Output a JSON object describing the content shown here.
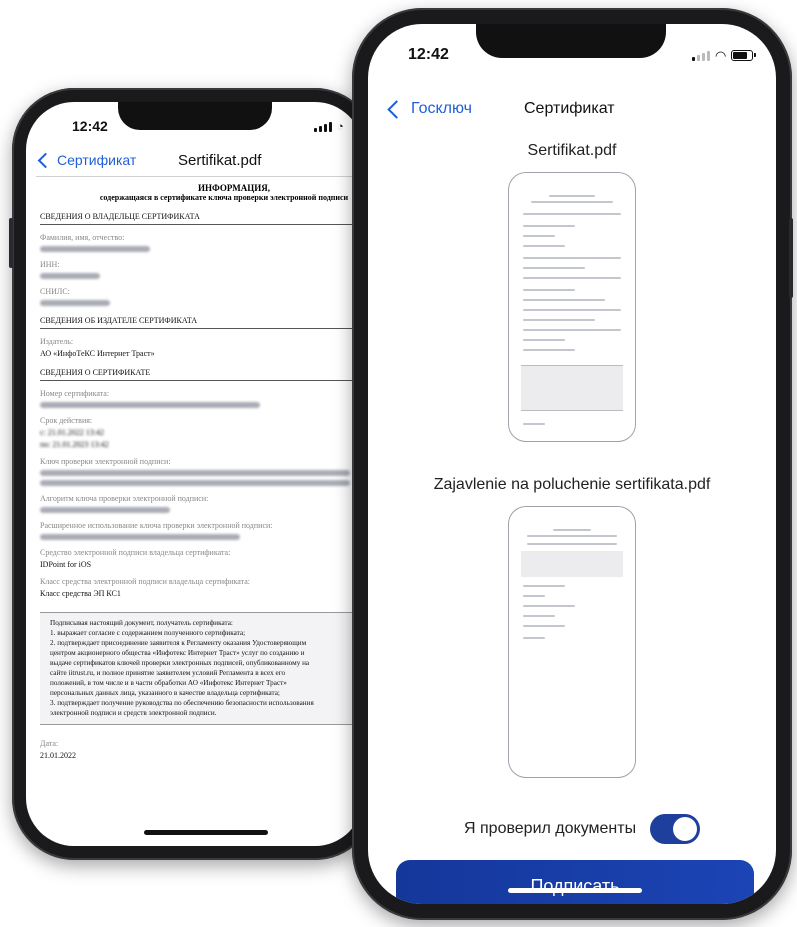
{
  "back_phone": {
    "status_time": "12:42",
    "nav": {
      "back_label": "Сертификат",
      "title": "Sertifikat.pdf"
    },
    "document": {
      "heading_line1": "ИНФОРМАЦИЯ,",
      "heading_line2": "содержащаяся в сертификате ключа проверки электронной подписи",
      "section_owner": "СВЕДЕНИЯ О ВЛАДЕЛЬЦЕ СЕРТИФИКАТА",
      "label_fio": "Фамилия, имя, отчество:",
      "label_inn": "ИНН:",
      "label_snils": "СНИЛС:",
      "section_issuer": "СВЕДЕНИЯ ОБ ИЗДАТЕЛЕ СЕРТИФИКАТА",
      "label_issuer": "Издатель:",
      "issuer_value": "АО «ИнфоТеКС Интернет Траст»",
      "section_cert": "СВЕДЕНИЯ О СЕРТИФИКАТЕ",
      "label_number": "Номер сертификата:",
      "label_validity": "Срок действия:",
      "validity_from": "с: 21.01.2022 13:42",
      "validity_to": "по: 21.01.2023 13:42",
      "label_key": "Ключ проверки электронной подписи:",
      "label_algorithm": "Алгоритм ключа проверки электронной подписи:",
      "label_usage": "Расширенное использование ключа проверки электронной подписи:",
      "label_tool": "Средство электронной подписи владельца сертификата:",
      "tool_value": "IDPoint for iOS",
      "label_class": "Класс средства электронной подписи владельца сертификата:",
      "class_value": "Класс средства ЭП КС1",
      "notice": [
        "Подписывая настоящий документ, получатель сертификата:",
        "1. выражает согласие с содержанием полученного сертификата;",
        "2. подтверждает присоединение заявителя к Регламенту оказания Удостоверяющим",
        "центром акционерного общества «Инфотекс Интернет Траст» услуг по созданию и",
        "выдаче сертификатов ключей проверки электронных подписей, опубликованному на",
        "сайте iitrust.ru, и полное принятие заявителем условий Регламента в всех его",
        "положений, в том числе и в части обработки АО «Инфотекс Интернет Траст»",
        "персональных данных лица, указанного в качестве владельца сертификата;",
        "3. подтверждает получение руководства по обеспечению безопасности использования",
        "электронной подписи и средств электронной подписи."
      ],
      "label_date": "Дата:",
      "date_value": "21.01.2022"
    }
  },
  "front_phone": {
    "status_time": "12:42",
    "nav": {
      "back_label": "Госключ",
      "title": "Сертификат"
    },
    "doc1_title": "Sertifikat.pdf",
    "doc2_title": "Zajavlenie na poluchenie sertifikata.pdf",
    "checkbox_label": "Я проверил документы",
    "sign_button": "Подписать"
  },
  "colors": {
    "accent": "#1f5fd6",
    "button": "#1c44b5",
    "toggle_on": "#1e3f9c"
  }
}
